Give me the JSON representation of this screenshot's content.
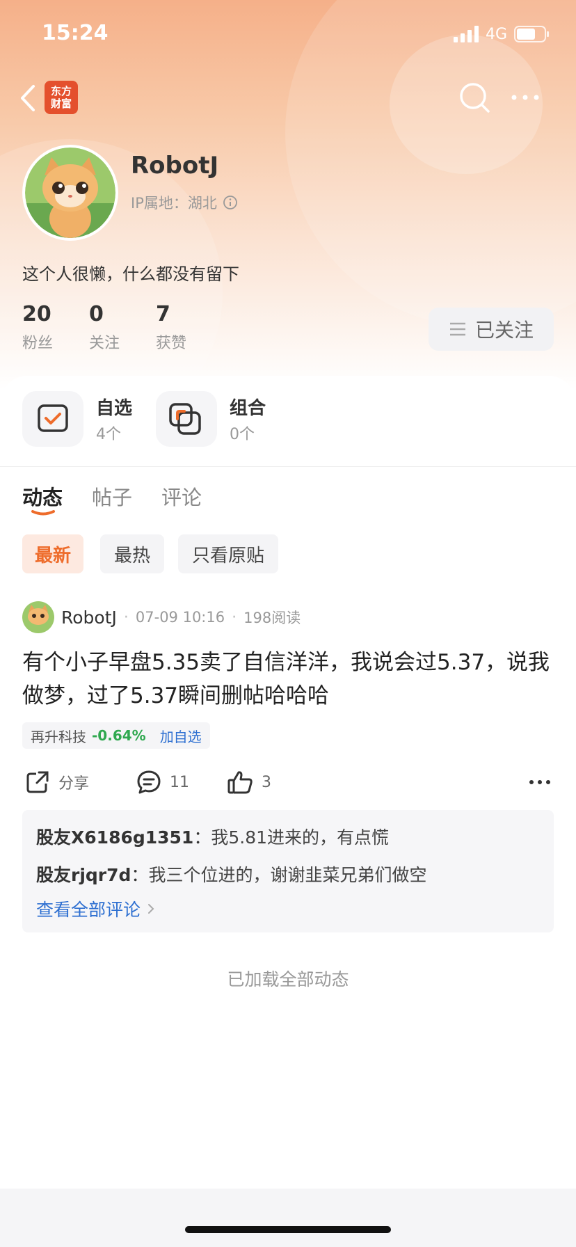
{
  "status_bar": {
    "time": "15:24",
    "network": "4G"
  },
  "nav": {
    "logo_text": "东方财富"
  },
  "profile": {
    "name": "RobotJ",
    "ip_location": "IP属地：湖北",
    "bio": "这个人很懒，什么都没有留下",
    "stats": [
      {
        "value": "20",
        "label": "粉丝"
      },
      {
        "value": "0",
        "label": "关注"
      },
      {
        "value": "7",
        "label": "获赞"
      }
    ],
    "follow_button": "已关注"
  },
  "features": [
    {
      "title": "自选",
      "sub": "4个",
      "icon": "watchlist-icon"
    },
    {
      "title": "组合",
      "sub": "0个",
      "icon": "portfolio-icon"
    }
  ],
  "tabs": [
    {
      "label": "动态"
    },
    {
      "label": "帖子"
    },
    {
      "label": "评论"
    }
  ],
  "filters": [
    {
      "label": "最新"
    },
    {
      "label": "最热"
    },
    {
      "label": "只看原贴"
    }
  ],
  "post": {
    "author": "RobotJ",
    "time": "07-09 10:16",
    "reads": "198阅读",
    "content": "有个小子早盘5.35卖了自信洋洋，我说会过5.37，说我做梦，过了5.37瞬间删帖哈哈哈",
    "stock": {
      "name": "再升科技",
      "change": "-0.64%",
      "add": "加自选"
    },
    "actions": {
      "share": "分享",
      "comments": "11",
      "likes": "3"
    },
    "replies": [
      {
        "user": "股友X6186g1351",
        "text": "我5.81进来的，有点慌"
      },
      {
        "user": "股友rjqr7d",
        "text": "我三个位进的，谢谢韭菜兄弟们做空"
      }
    ],
    "view_all": "查看全部评论"
  },
  "footer": {
    "loaded_all": "已加载全部动态"
  },
  "colors": {
    "accent": "#ee6c2b",
    "down_green": "#2fa84f",
    "link_blue": "#2d6fd1"
  }
}
